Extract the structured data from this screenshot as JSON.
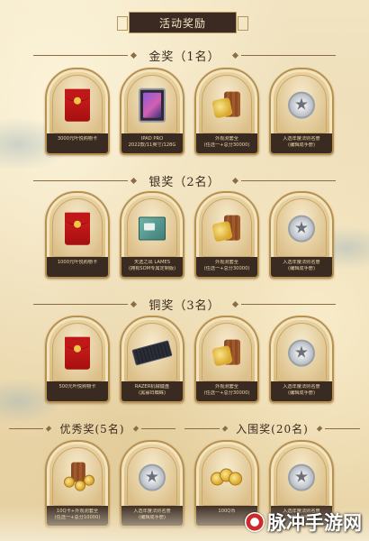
{
  "title": "活动奖励",
  "sections": [
    {
      "id": "gold",
      "header": "金奖（1名）",
      "prizes": [
        {
          "icon": "red-envelope-icon",
          "lines": [
            "3000元叶悦购物卡"
          ]
        },
        {
          "icon": "tablet-icon",
          "lines": [
            "IPAD PRO",
            "2022款/11英寸/128G"
          ]
        },
        {
          "icon": "gift-pack-icon",
          "lines": [
            "外观测套全",
            "(任选一+总分30000)"
          ]
        },
        {
          "icon": "star-badge-icon",
          "lines": [
            "入选年度法则名册",
            "(编辑成手册)"
          ]
        }
      ]
    },
    {
      "id": "silver",
      "header": "银奖（2名）",
      "prizes": [
        {
          "icon": "red-envelope-icon",
          "lines": [
            "1000元叶悦购物卡"
          ]
        },
        {
          "icon": "computer-box-icon",
          "lines": [
            "天选之出 LAMES",
            "(拥有SOM专属定制版)"
          ]
        },
        {
          "icon": "gift-pack-icon",
          "lines": [
            "外观测套全",
            "(任选一+总分30000)"
          ]
        },
        {
          "icon": "star-badge-icon",
          "lines": [
            "入选年度法则名册",
            "(编辑成手册)"
          ]
        }
      ]
    },
    {
      "id": "bronze",
      "header": "铜奖（3名）",
      "prizes": [
        {
          "icon": "red-envelope-icon",
          "lines": [
            "500元叶悦购物卡"
          ]
        },
        {
          "icon": "keyboard-icon",
          "lines": [
            "RAZER机械键盘",
            "(黑寡妇蜘蛛)"
          ]
        },
        {
          "icon": "gift-pack-icon",
          "lines": [
            "外观测套全",
            "(任选一+总分30000)"
          ]
        },
        {
          "icon": "star-badge-icon",
          "lines": [
            "入选年度法则名册",
            "(编辑成手册)"
          ]
        }
      ]
    }
  ],
  "excellent": {
    "header": "优秀奖(5名)",
    "prizes": [
      {
        "icon": "mixed-gift-icon",
        "lines": [
          "10Q卡+外观测套全",
          "(任选一+总分10000)"
        ]
      },
      {
        "icon": "star-badge-icon",
        "lines": [
          "入选年度法则名册",
          "(编辑成手册)"
        ]
      }
    ]
  },
  "finalist": {
    "header": "入围奖(20名)",
    "prizes": [
      {
        "icon": "coins-icon",
        "lines": [
          "100Q币"
        ]
      },
      {
        "icon": "star-badge-icon",
        "lines": [
          "入选年度法则名册",
          "(编辑成手册)"
        ]
      }
    ]
  },
  "watermark": "脉冲手游网"
}
